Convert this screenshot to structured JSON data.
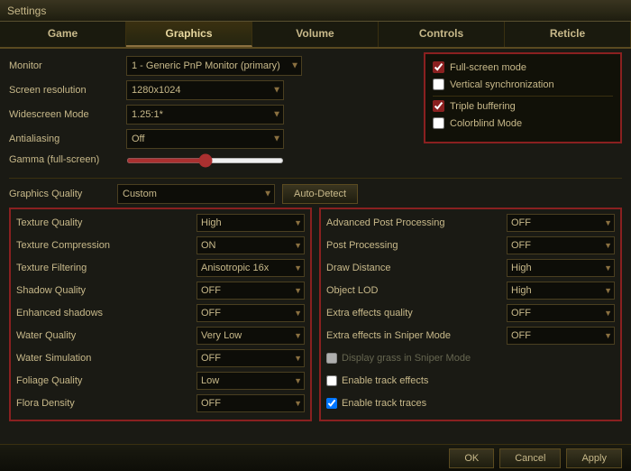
{
  "titleBar": {
    "text": "Settings"
  },
  "tabs": [
    {
      "id": "game",
      "label": "Game",
      "active": false
    },
    {
      "id": "graphics",
      "label": "Graphics",
      "active": true
    },
    {
      "id": "volume",
      "label": "Volume",
      "active": false
    },
    {
      "id": "controls",
      "label": "Controls",
      "active": false
    },
    {
      "id": "reticle",
      "label": "Reticle",
      "active": false
    }
  ],
  "leftSettings": [
    {
      "label": "Monitor",
      "value": "1 - Generic PnP Monitor (primary)",
      "type": "select"
    },
    {
      "label": "Screen resolution",
      "value": "1280x1024",
      "type": "select"
    },
    {
      "label": "Widescreen Mode",
      "value": "1.25:1*",
      "type": "select"
    },
    {
      "label": "Antialiasing",
      "value": "Off",
      "type": "select"
    },
    {
      "label": "Gamma (full-screen)",
      "value": "",
      "type": "slider"
    }
  ],
  "rightPanel": {
    "checks": [
      {
        "label": "Full-screen mode",
        "checked": true
      },
      {
        "label": "Vertical synchronization",
        "checked": false
      },
      {
        "label": "Triple buffering",
        "checked": true
      },
      {
        "label": "Colorblind Mode",
        "checked": false
      }
    ]
  },
  "graphicsQuality": {
    "label": "Graphics Quality",
    "value": "Custom",
    "autoDetect": "Auto-Detect"
  },
  "leftGrid": [
    {
      "label": "Texture Quality",
      "value": "High"
    },
    {
      "label": "Texture Compression",
      "value": "ON"
    },
    {
      "label": "Texture Filtering",
      "value": "Anisotropic 16x"
    },
    {
      "label": "Shadow Quality",
      "value": "OFF"
    },
    {
      "label": "Enhanced shadows",
      "value": "OFF"
    },
    {
      "label": "Water Quality",
      "value": "Very Low"
    },
    {
      "label": "Water Simulation",
      "value": "OFF"
    },
    {
      "label": "Foliage Quality",
      "value": "Low"
    },
    {
      "label": "Flora Density",
      "value": "OFF"
    }
  ],
  "rightGrid": [
    {
      "label": "Advanced Post Processing",
      "value": "OFF"
    },
    {
      "label": "Post Processing",
      "value": "OFF"
    },
    {
      "label": "Draw Distance",
      "value": "High"
    },
    {
      "label": "Object LOD",
      "value": "High"
    },
    {
      "label": "Extra effects quality",
      "value": "OFF"
    },
    {
      "label": "Extra effects in Sniper Mode",
      "value": "OFF"
    },
    {
      "label": "Display grass in Sniper Mode",
      "value": "",
      "type": "checkbox",
      "checked": false,
      "disabled": true
    },
    {
      "label": "Enable track effects",
      "value": "",
      "type": "checkbox",
      "checked": false,
      "disabled": false
    },
    {
      "label": "Enable track traces",
      "value": "",
      "type": "checkbox",
      "checked": true,
      "disabled": false
    }
  ],
  "bottomBar": {
    "ok": "OK",
    "cancel": "Cancel",
    "apply": "Apply"
  }
}
